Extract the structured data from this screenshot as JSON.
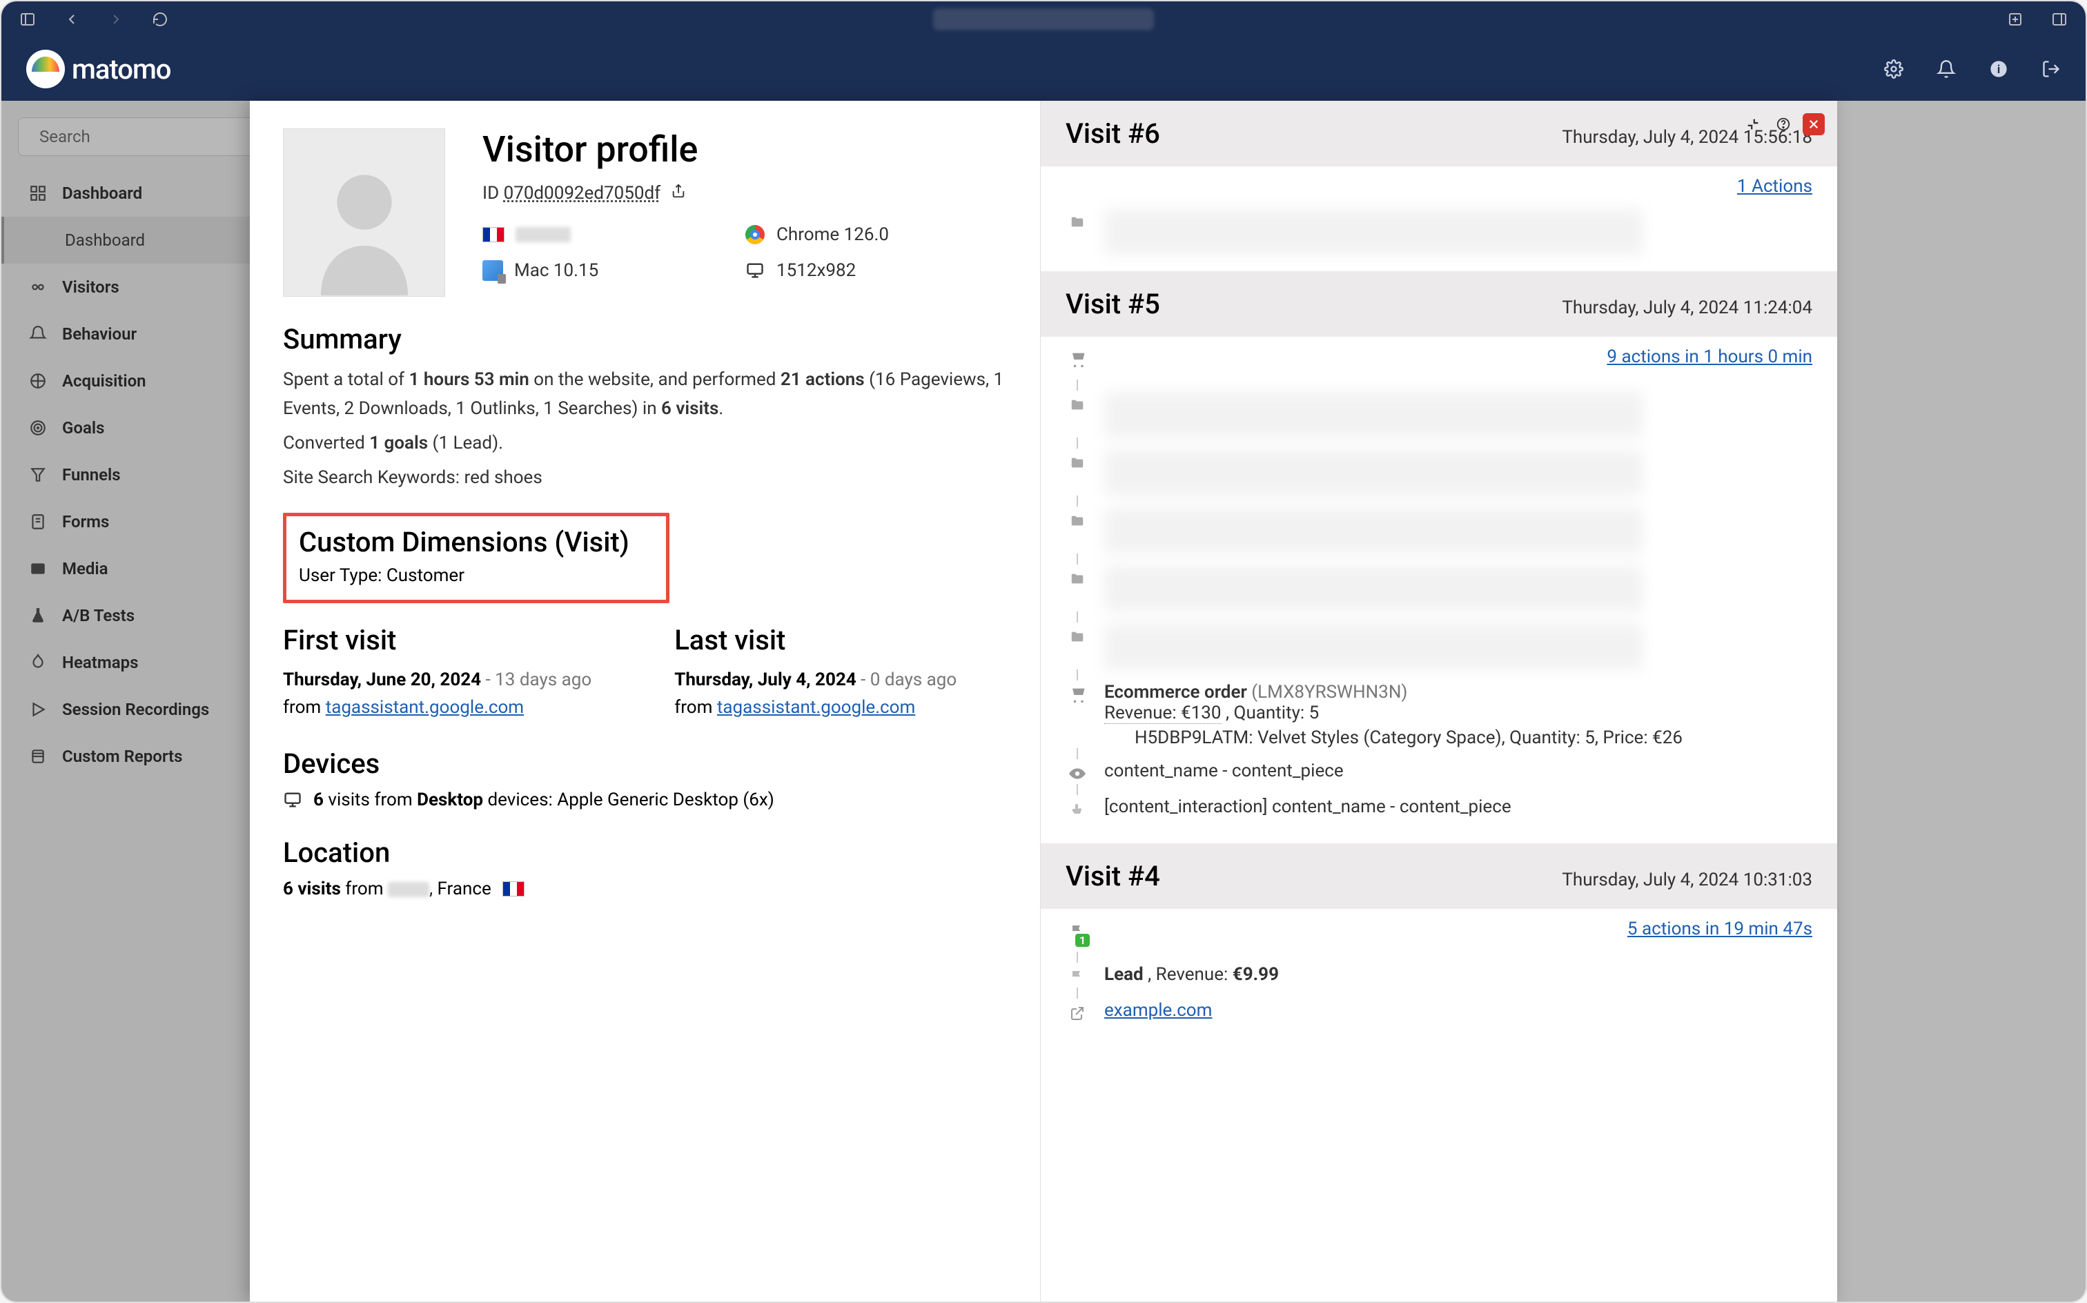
{
  "titlebar": {},
  "header": {
    "brand": "matomo"
  },
  "search": {
    "placeholder": "Search"
  },
  "sidebar": {
    "items": [
      {
        "label": "Dashboard"
      },
      {
        "label": "Dashboard",
        "sub": true
      },
      {
        "label": "Visitors"
      },
      {
        "label": "Behaviour"
      },
      {
        "label": "Acquisition"
      },
      {
        "label": "Goals"
      },
      {
        "label": "Funnels"
      },
      {
        "label": "Forms"
      },
      {
        "label": "Media"
      },
      {
        "label": "A/B Tests"
      },
      {
        "label": "Heatmaps"
      },
      {
        "label": "Session Recordings"
      },
      {
        "label": "Custom Reports"
      }
    ]
  },
  "profile": {
    "title": "Visitor profile",
    "id_label": "ID",
    "id_value": "070d0092ed7050df",
    "browser": "Chrome 126.0",
    "os": "Mac 10.15",
    "resolution": "1512x982"
  },
  "summary": {
    "heading": "Summary",
    "pre1": "Spent a total of ",
    "time": "1 hours 53 min",
    "mid1": " on the website, and performed ",
    "actions": "21 actions",
    "post1": " (16 Pageviews, 1 Events, 2 Downloads, 1 Outlinks, 1 Searches) in ",
    "visits": "6 visits",
    "dot": ".",
    "conv_pre": "Converted ",
    "conv_goals": "1 goals",
    "conv_post": " (1 Lead).",
    "ssk_label": "Site Search Keywords: ",
    "ssk_value": "red shoes"
  },
  "cd": {
    "heading": "Custom Dimensions (Visit)",
    "key": "User Type: ",
    "value": "Customer"
  },
  "first_visit": {
    "heading": "First visit",
    "date": "Thursday, June 20, 2024",
    "ago": " - 13 days ago",
    "from": "from ",
    "ref": "tagassistant.google.com"
  },
  "last_visit": {
    "heading": "Last visit",
    "date": "Thursday, July 4, 2024",
    "ago": " - 0 days ago",
    "from": "from ",
    "ref": "tagassistant.google.com"
  },
  "devices": {
    "heading": "Devices",
    "count": "6",
    "mid": " visits from ",
    "type": "Desktop",
    "post": " devices: Apple Generic Desktop (6x)"
  },
  "location": {
    "heading": "Location",
    "count": "6 visits",
    "from": " from ",
    "country": ", France"
  },
  "visits": {
    "v6": {
      "title": "Visit #6",
      "dt": "Thursday, July 4, 2024 15:56:18",
      "actions": "1 Actions"
    },
    "v5": {
      "title": "Visit #5",
      "dt": "Thursday, July 4, 2024 11:24:04",
      "actions": "9 actions in 1 hours 0 min",
      "order_label": "Ecommerce order",
      "order_id": "(LMX8YRSWHN3N)",
      "rev_label": "Revenue: €130",
      "qty": " , Quantity: 5",
      "item": "H5DBP9LATM: Velvet Styles (Category Space), Quantity: 5, Price: €26",
      "content1": "content_name - content_piece",
      "content2": "[content_interaction] content_name - content_piece"
    },
    "v4": {
      "title": "Visit #4",
      "dt": "Thursday, July 4, 2024 10:31:03",
      "actions": "5 actions in 19 min 47s",
      "badge": "1",
      "lead_label": "Lead",
      "lead_rev_pre": " , Revenue: ",
      "lead_rev": "€9.99",
      "link": "example.com"
    }
  }
}
